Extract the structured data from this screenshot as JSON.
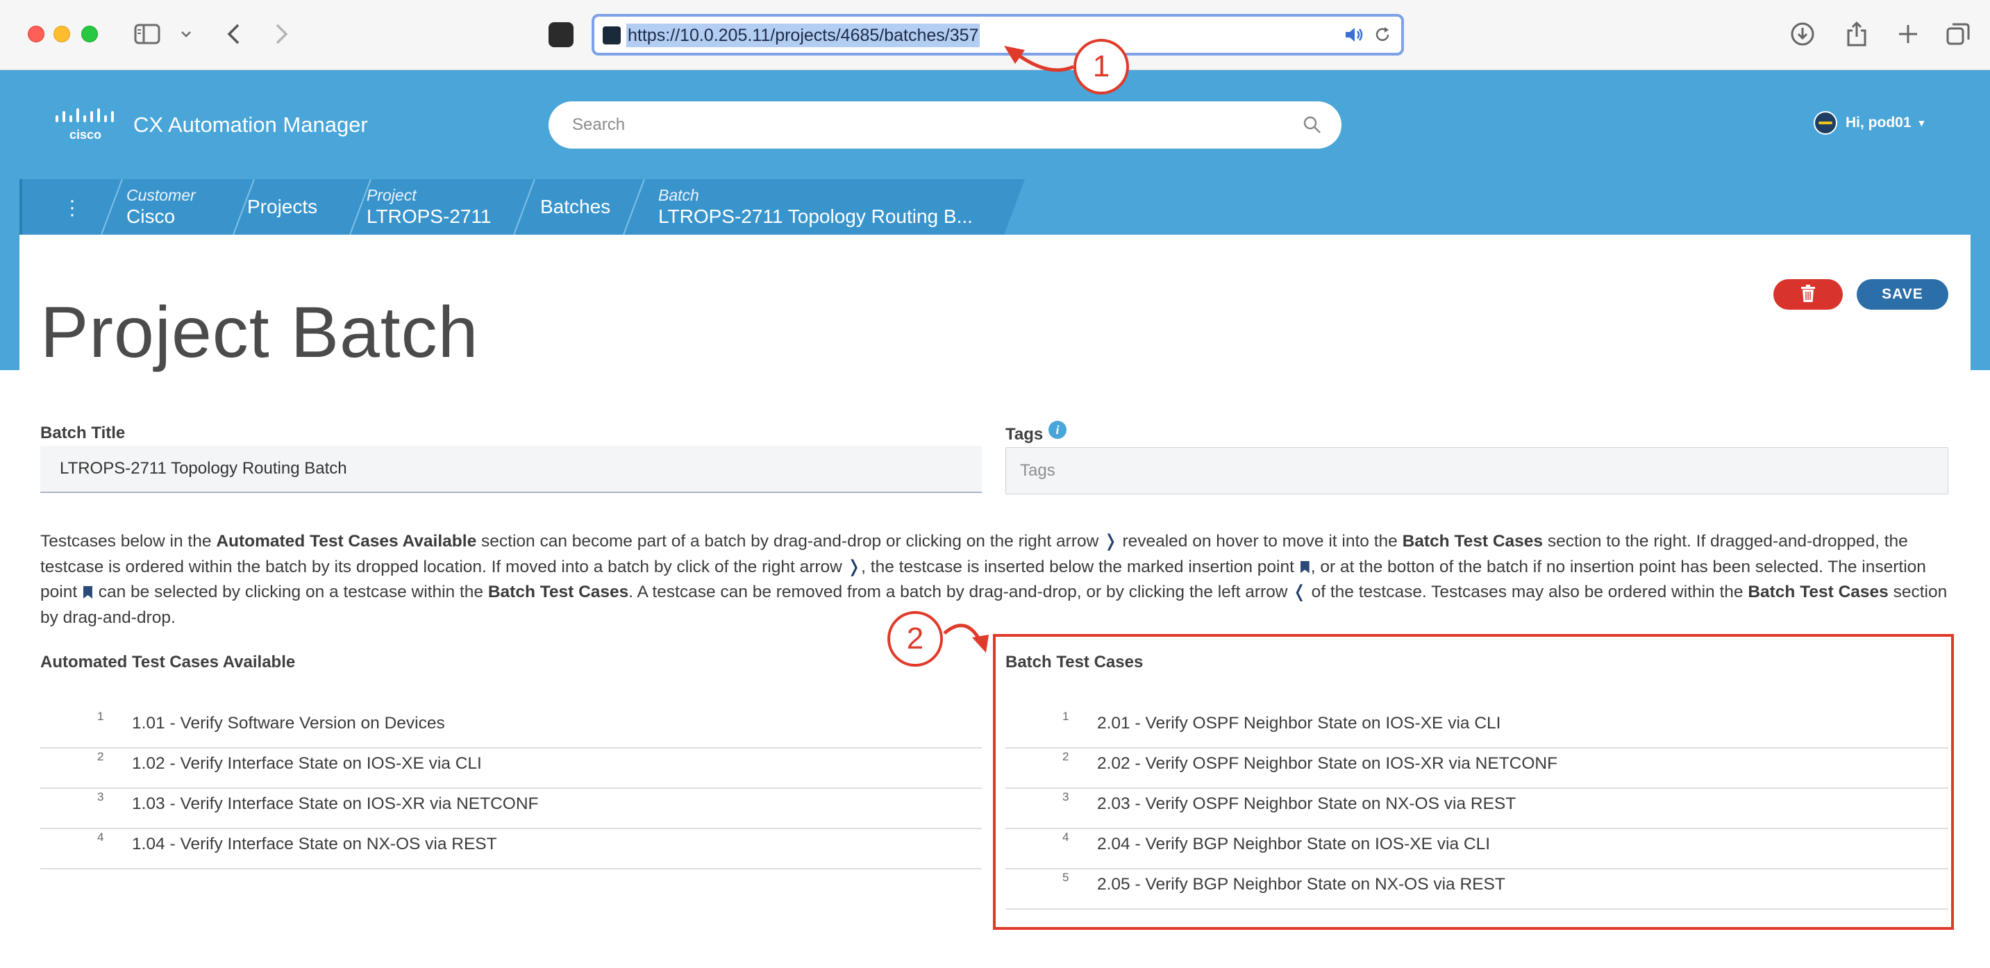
{
  "browser": {
    "url": "https://10.0.205.11/projects/4685/batches/357"
  },
  "app": {
    "title": "CX Automation Manager",
    "search_placeholder": "Search",
    "user_greeting": "Hi, pod01"
  },
  "breadcrumb": [
    {
      "small": "Customer",
      "value": "Cisco"
    },
    {
      "small": "",
      "value": "Projects"
    },
    {
      "small": "Project",
      "value": "LTROPS-2711"
    },
    {
      "small": "",
      "value": "Batches"
    },
    {
      "small": "Batch",
      "value": "LTROPS-2711 Topology Routing B..."
    }
  ],
  "page": {
    "title": "Project Batch",
    "save_label": "SAVE"
  },
  "form": {
    "batch_title_label": "Batch Title",
    "batch_title_value": "LTROPS-2711 Topology Routing Batch",
    "tags_label": "Tags",
    "tags_placeholder": "Tags"
  },
  "help": {
    "s1": "Testcases below in the ",
    "b1": "Automated Test Cases Available",
    "s2": " section can become part of a batch by drag-and-drop or clicking on the right arrow ",
    "s3": " revealed on hover to move it into the ",
    "b2": "Batch Test Cases",
    "s4": " section to the right. If dragged-and-dropped, the testcase is ordered within the batch by its dropped location. If moved into a batch by click of the right arrow ",
    "s5": ", the testcase is inserted below the marked insertion point ",
    "s6": ", or at the botton of the batch if no insertion point has been selected. The insertion point ",
    "s7": " can be selected by clicking on a testcase within the ",
    "b3": "Batch Test Cases",
    "s8": ". A testcase can be removed from a batch by drag-and-drop, or by clicking the left arrow ",
    "s9": " of the testcase. Testcases may also be ordered within the ",
    "b4": "Batch Test Cases",
    "s10": " section by drag-and-drop."
  },
  "available": {
    "heading": "Automated Test Cases Available",
    "items": [
      {
        "num": "1",
        "name": "1.01 - Verify Software Version on Devices"
      },
      {
        "num": "2",
        "name": "1.02 - Verify Interface State on IOS-XE via CLI"
      },
      {
        "num": "3",
        "name": "1.03 - Verify Interface State on IOS-XR via NETCONF"
      },
      {
        "num": "4",
        "name": "1.04 - Verify Interface State on NX-OS via REST"
      }
    ]
  },
  "batch": {
    "heading": "Batch Test Cases",
    "items": [
      {
        "num": "1",
        "name": "2.01 - Verify OSPF Neighbor State on IOS-XE via CLI"
      },
      {
        "num": "2",
        "name": "2.02 - Verify OSPF Neighbor State on IOS-XR via NETCONF"
      },
      {
        "num": "3",
        "name": "2.03 - Verify OSPF Neighbor State on NX-OS via REST"
      },
      {
        "num": "4",
        "name": "2.04 - Verify BGP Neighbor State on IOS-XE via CLI"
      },
      {
        "num": "5",
        "name": "2.05 - Verify BGP Neighbor State on NX-OS via REST"
      }
    ]
  },
  "annotations": {
    "callout_1": "1",
    "callout_2": "2",
    "color": "#e03a2a"
  },
  "colors": {
    "header_blue": "#4aa5d9",
    "save_blue": "#2b6ea8",
    "delete_red": "#d9342b"
  },
  "icons": {
    "sidebar": "sidebar-icon",
    "back": "chevron-left-icon",
    "forward": "chevron-right-icon",
    "download": "download-icon",
    "share": "share-icon",
    "new_tab": "plus-icon",
    "tabs": "tabs-icon",
    "search": "search-icon",
    "delete": "trash-icon",
    "info": "info-icon",
    "bookmark": "bookmark-icon"
  }
}
